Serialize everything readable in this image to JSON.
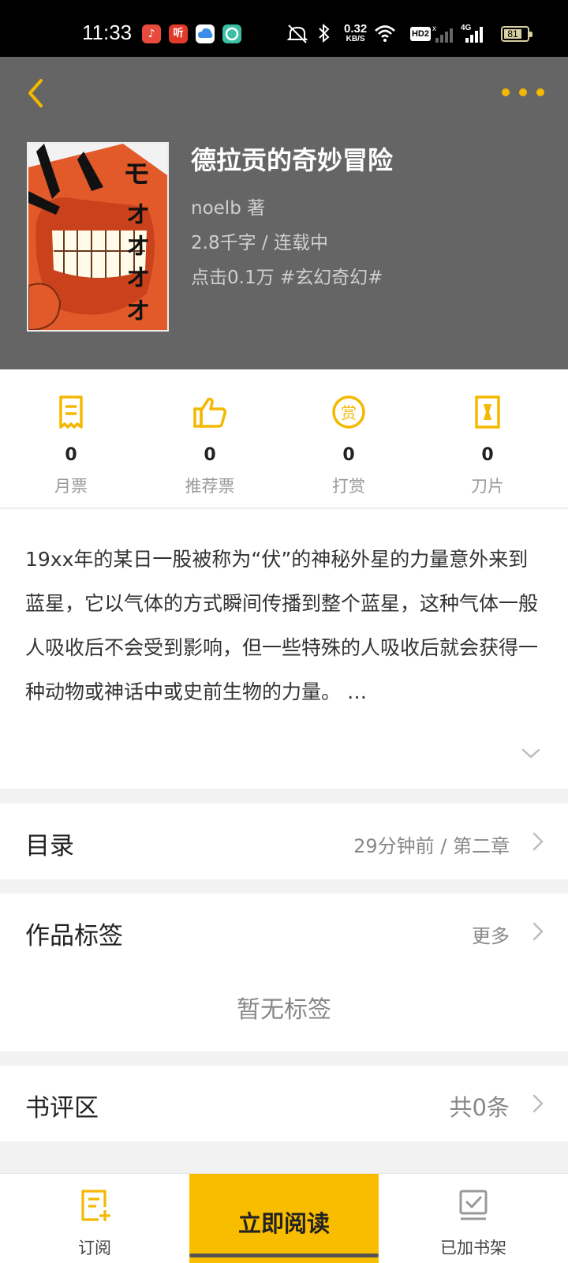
{
  "status_bar": {
    "time": "11:33",
    "net_speed_value": "0.32",
    "net_speed_unit": "KB/S",
    "hd_badge": "HD2",
    "net_type": "4G",
    "battery": "81",
    "app_badge_listen": "听",
    "icons": [
      "music-app-icon",
      "listen-app-icon",
      "cloud-app-icon",
      "chat-app-icon",
      "mute-icon",
      "bluetooth-icon",
      "wifi-icon",
      "signal-icon",
      "battery-icon"
    ]
  },
  "header": {
    "book_title": "德拉贡的奇妙冒险",
    "author_line": "noelb  著",
    "size_status": "2.8千字 / 连载中",
    "clicks_genre": "点击0.1万  #玄幻奇幻#",
    "accent_color": "#f5b800"
  },
  "stats": [
    {
      "icon": "ticket-icon",
      "value": "0",
      "label": "月票"
    },
    {
      "icon": "thumbs-up-icon",
      "value": "0",
      "label": "推荐票"
    },
    {
      "icon": "reward-coin-icon",
      "value": "0",
      "label": "打赏"
    },
    {
      "icon": "blade-icon",
      "value": "0",
      "label": "刀片"
    }
  ],
  "synopsis": {
    "text": "19xx年的某日一股被称为“伏”的神秘外星的力量意外来到蓝星，它以气体的方式瞬间传播到整个蓝星，这种气体一般人吸收后不会受到影响，但一些特殊的人吸收后就会获得一种动物或神话中或史前生物的力量。 …"
  },
  "toc": {
    "title": "目录",
    "latest": "29分钟前 / 第二章"
  },
  "tags": {
    "title": "作品标签",
    "more": "更多",
    "empty": "暂无标签"
  },
  "reviews": {
    "title": "书评区",
    "count": "共0条"
  },
  "bottom_bar": {
    "subscribe": "订阅",
    "read_now": "立即阅读",
    "in_shelf": "已加书架",
    "read_color": "#f9bd00"
  }
}
